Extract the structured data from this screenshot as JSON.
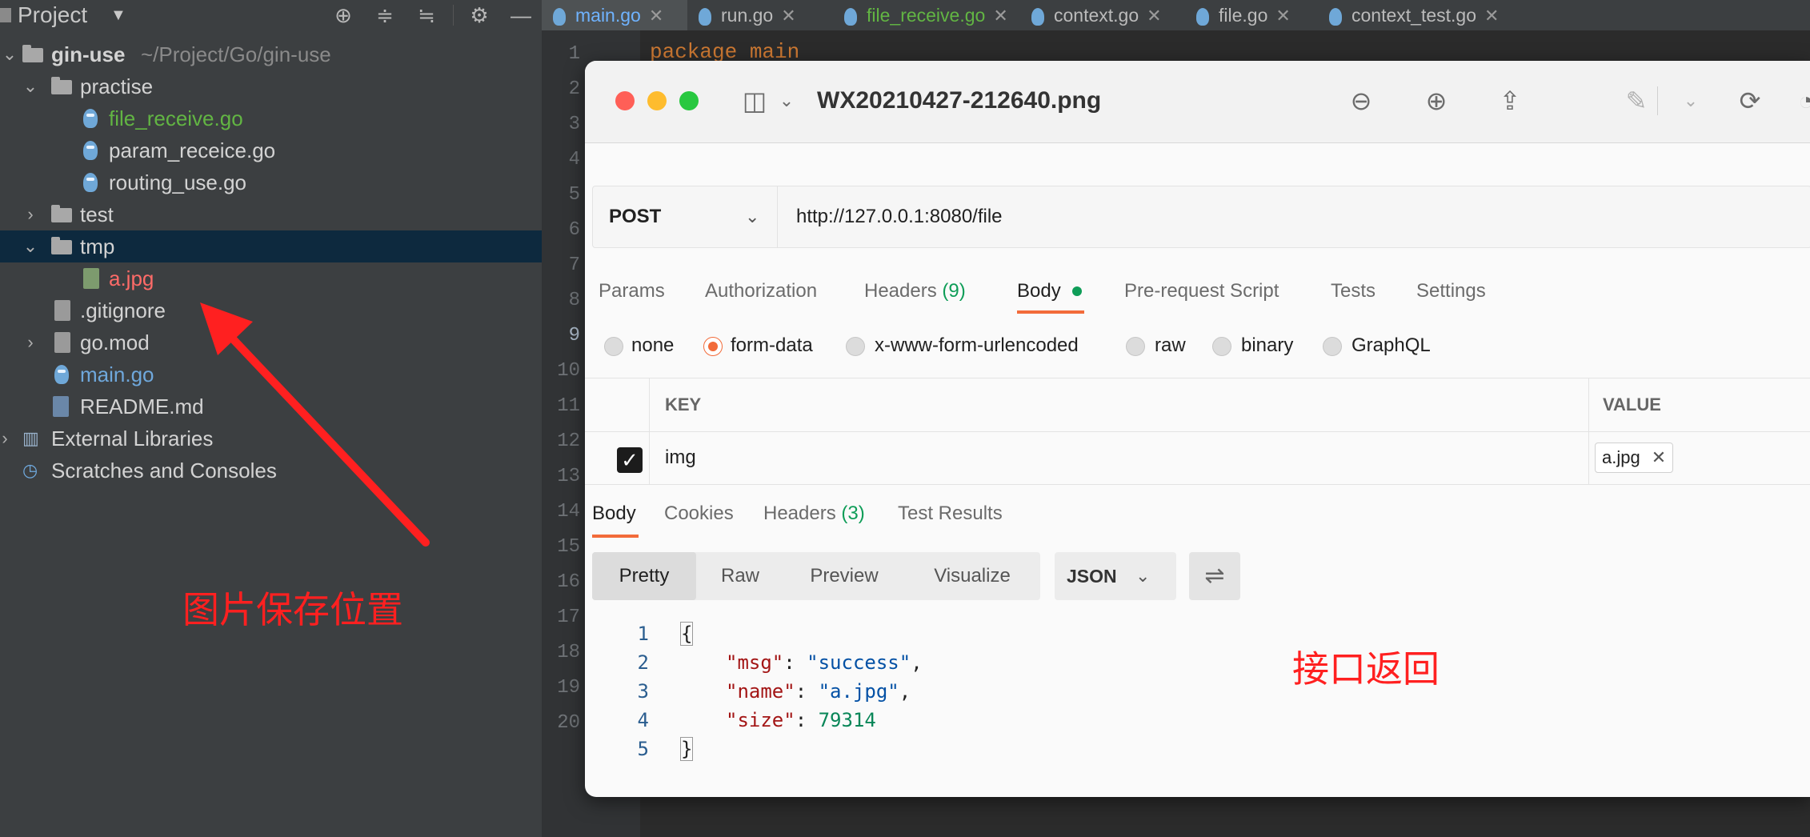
{
  "project_panel": {
    "title": "Project",
    "tree": [
      {
        "label": "gin-use",
        "path": "~/Project/Go/gin-use"
      },
      {
        "label": "practise"
      },
      {
        "label": "file_receive.go"
      },
      {
        "label": "param_receice.go"
      },
      {
        "label": "routing_use.go"
      },
      {
        "label": "test"
      },
      {
        "label": "tmp"
      },
      {
        "label": "a.jpg"
      },
      {
        "label": ".gitignore"
      },
      {
        "label": "go.mod"
      },
      {
        "label": "main.go"
      },
      {
        "label": "README.md"
      },
      {
        "label": "External Libraries"
      },
      {
        "label": "Scratches and Consoles"
      }
    ]
  },
  "editor": {
    "tabs": [
      {
        "label": "main.go"
      },
      {
        "label": "run.go"
      },
      {
        "label": "file_receive.go"
      },
      {
        "label": "context.go"
      },
      {
        "label": "file.go"
      },
      {
        "label": "context_test.go"
      }
    ],
    "line_numbers": [
      "1",
      "2",
      "3",
      "4",
      "5",
      "6",
      "7",
      "8",
      "9",
      "10",
      "11",
      "12",
      "13",
      "14",
      "15",
      "16",
      "17",
      "18",
      "19",
      "20"
    ],
    "code_line_1": "package main"
  },
  "preview": {
    "title": "WX20210427-212640.png",
    "request": {
      "method": "POST",
      "url": "http://127.0.0.1:8080/file",
      "tabs": {
        "params": "Params",
        "authorization": "Authorization",
        "headers": "Headers",
        "headers_count": "(9)",
        "body": "Body",
        "pre_request": "Pre-request Script",
        "tests": "Tests",
        "settings": "Settings"
      },
      "body_modes": {
        "none": "none",
        "form_data": "form-data",
        "urlencoded": "x-www-form-urlencoded",
        "raw": "raw",
        "binary": "binary",
        "graphql": "GraphQL"
      },
      "table": {
        "key_header": "KEY",
        "value_header": "VALUE",
        "row_key": "img",
        "row_value": "a.jpg"
      }
    },
    "response": {
      "tabs": {
        "body": "Body",
        "cookies": "Cookies",
        "headers": "Headers",
        "headers_count": "(3)",
        "test_results": "Test Results"
      },
      "views": {
        "pretty": "Pretty",
        "raw": "Raw",
        "preview": "Preview",
        "visualize": "Visualize"
      },
      "format": "JSON",
      "lines": {
        "n1": "1",
        "n2": "2",
        "n3": "3",
        "n4": "4",
        "n5": "5",
        "open": "{",
        "close": "}",
        "msg_key": "\"msg\"",
        "msg_val": "\"success\"",
        "name_key": "\"name\"",
        "name_val": "\"a.jpg\"",
        "size_key": "\"size\"",
        "size_val": "79314"
      }
    }
  },
  "annotations": {
    "save_location": "图片保存位置",
    "api_return": "接口返回"
  },
  "colors": {
    "ide_bg": "#2b2b2b",
    "sidebar_bg": "#3c3f41",
    "selection": "#0d293e",
    "accent_orange": "#f26b3a",
    "annotation_red": "#ff2020"
  }
}
